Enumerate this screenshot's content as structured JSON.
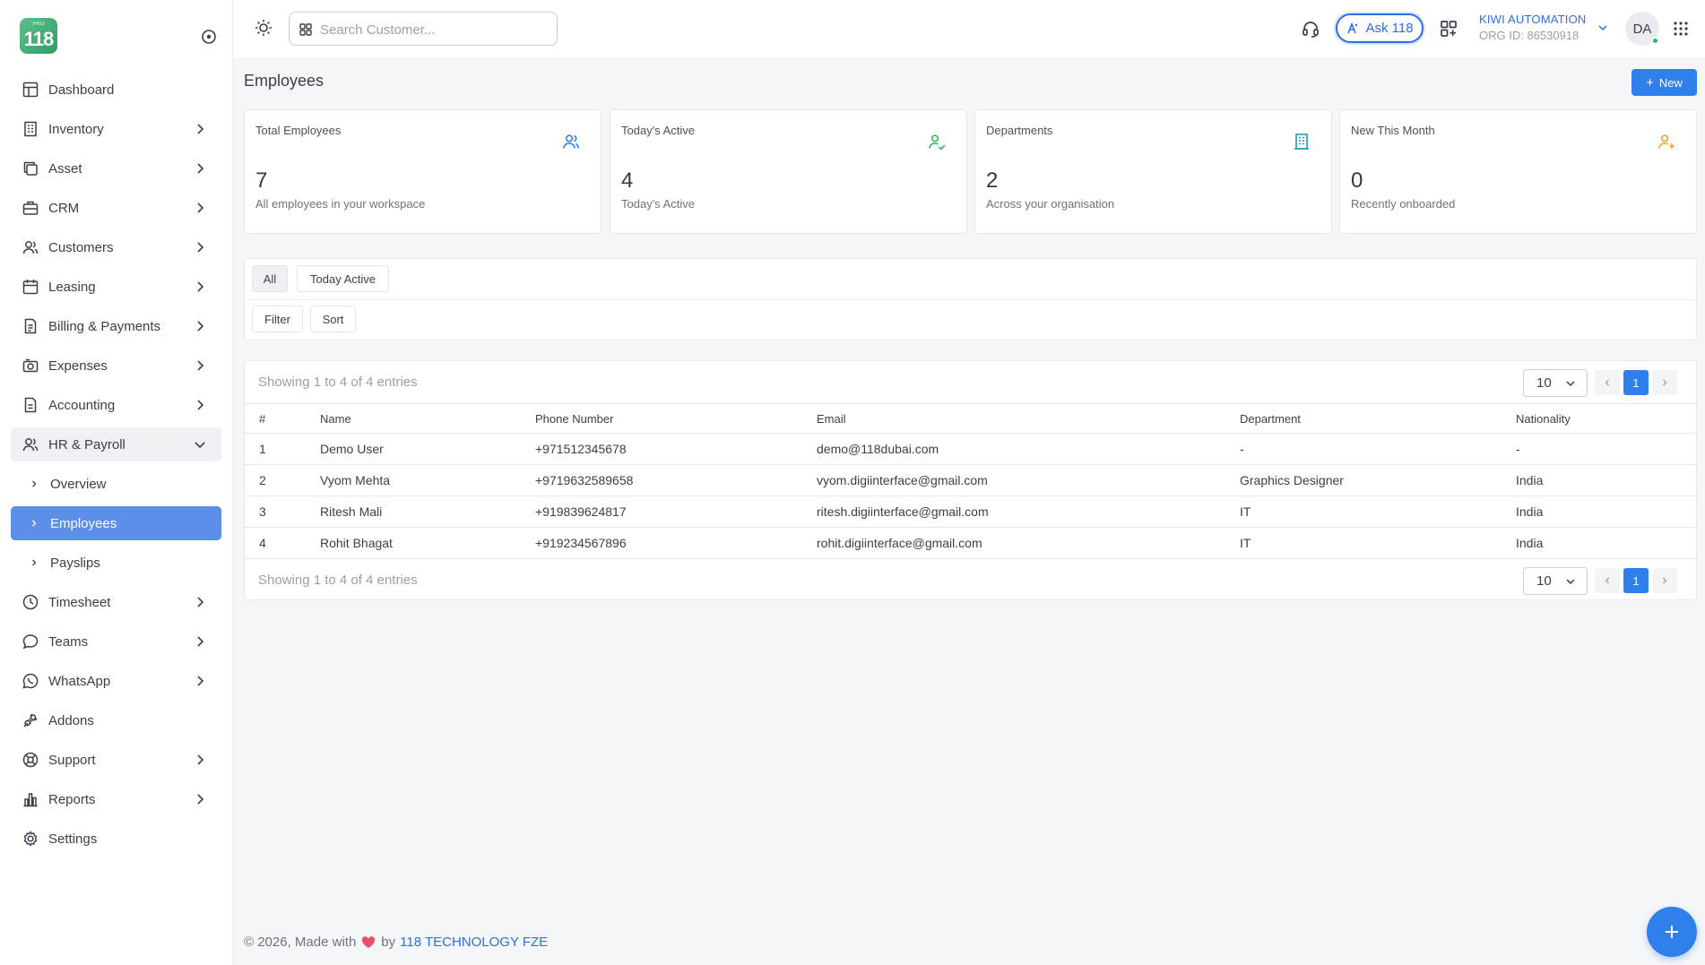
{
  "brand": {
    "logo_small": "PRO",
    "logo_number": "118"
  },
  "search": {
    "placeholder": "Search Customer..."
  },
  "topbar": {
    "ask_label": "Ask 118",
    "org_name": "KIWI AUTOMATION",
    "org_id": "ORG ID: 86530918",
    "avatar_initials": "DA"
  },
  "sidebar": {
    "items": [
      {
        "label": "Dashboard",
        "icon": "dashboard-icon"
      },
      {
        "label": "Inventory",
        "icon": "building-icon"
      },
      {
        "label": "Asset",
        "icon": "copy-icon"
      },
      {
        "label": "CRM",
        "icon": "briefcase-icon"
      },
      {
        "label": "Customers",
        "icon": "users-icon"
      },
      {
        "label": "Leasing",
        "icon": "calendar-icon"
      },
      {
        "label": "Billing & Payments",
        "icon": "invoice-icon"
      },
      {
        "label": "Expenses",
        "icon": "camera-icon"
      },
      {
        "label": "Accounting",
        "icon": "ledger-icon"
      },
      {
        "label": "HR & Payroll",
        "icon": "users-icon"
      },
      {
        "label": "Overview"
      },
      {
        "label": "Employees"
      },
      {
        "label": "Payslips"
      },
      {
        "label": "Timesheet",
        "icon": "clock-icon"
      },
      {
        "label": "Teams",
        "icon": "chat-icon"
      },
      {
        "label": "WhatsApp",
        "icon": "whatsapp-icon"
      },
      {
        "label": "Addons",
        "icon": "plug-icon"
      },
      {
        "label": "Support",
        "icon": "lifebuoy-icon"
      },
      {
        "label": "Reports",
        "icon": "bar-chart-icon"
      },
      {
        "label": "Settings",
        "icon": "gear-icon"
      }
    ]
  },
  "page": {
    "title": "Employees",
    "new_label": "New"
  },
  "stats": [
    {
      "label": "Total Employees",
      "value": "7",
      "sub": "All employees in your workspace",
      "icon": "users-icon",
      "color": "#2f80ed"
    },
    {
      "label": "Today's Active",
      "value": "4",
      "sub": "Today's Active",
      "icon": "user-check-icon",
      "color": "#2fb862"
    },
    {
      "label": "Departments",
      "value": "2",
      "sub": "Across your organisation",
      "icon": "building-icon",
      "color": "#17a2b8"
    },
    {
      "label": "New This Month",
      "value": "0",
      "sub": "Recently onboarded",
      "icon": "user-plus-icon",
      "color": "#f0a030"
    }
  ],
  "filters": {
    "all": "All",
    "today_active": "Today Active",
    "filter": "Filter",
    "sort": "Sort"
  },
  "table": {
    "showing_text": "Showing 1 to 4 of 4 entries",
    "page_size": "10",
    "current_page": "1",
    "columns": [
      "#",
      "Name",
      "Phone Number",
      "Email",
      "Department",
      "Nationality"
    ],
    "rows": [
      [
        "1",
        "Demo User",
        "+971512345678",
        "demo@118dubai.com",
        "-",
        "-"
      ],
      [
        "2",
        "Vyom Mehta",
        "+9719632589658",
        "vyom.digiinterface@gmail.com",
        "Graphics Designer",
        "India"
      ],
      [
        "3",
        "Ritesh Mali",
        "+919839624817",
        "ritesh.digiinterface@gmail.com",
        "IT",
        "India"
      ],
      [
        "4",
        "Rohit Bhagat",
        "+919234567896",
        "rohit.digiinterface@gmail.com",
        "IT",
        "India"
      ]
    ]
  },
  "footer": {
    "prefix": "© 2026, Made with",
    "by": "by",
    "company": "118 TECHNOLOGY FZE"
  },
  "colors": {
    "accent": "#2f80ed",
    "active_nav": "#5b8fe8"
  }
}
